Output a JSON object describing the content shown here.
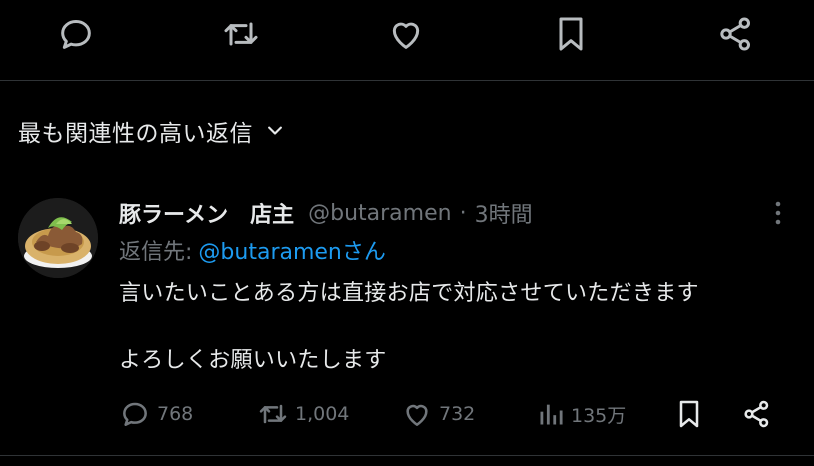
{
  "top_actions": [
    "reply-icon",
    "repost-icon",
    "like-icon",
    "bookmark-icon",
    "share-icon"
  ],
  "sort": {
    "label": "最も関連性の高い返信"
  },
  "reply": {
    "author_name": "豚ラーメン　店主",
    "handle": "@butaramen",
    "separator": "·",
    "time": "3時間",
    "reply_to_label": "返信先:",
    "reply_to_handle": "@butaramenさん",
    "line1": "言いたいことある方は直接お店で対応させていただきます",
    "line2": "よろしくお願いいたします",
    "stats": {
      "replies": "768",
      "reposts": "1,004",
      "likes": "732",
      "views": "135万"
    }
  },
  "colors": {
    "background": "#000000",
    "text": "#e7e9ea",
    "muted": "#71767b",
    "link": "#1d9bf0",
    "divider": "#2f3336"
  }
}
